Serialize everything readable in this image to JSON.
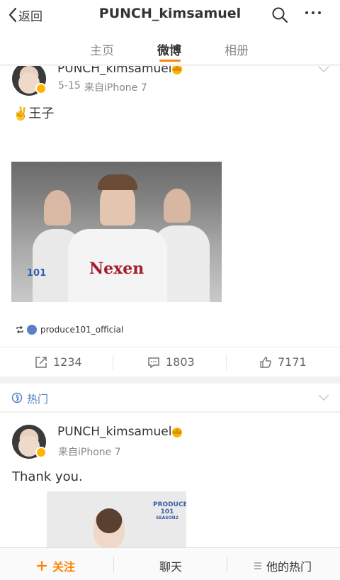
{
  "nav": {
    "back_label": "返回",
    "title": "PUNCH_kimsamuel",
    "search_icon": "search-icon",
    "more_icon": "more-icon"
  },
  "tabs": [
    {
      "label": "主页",
      "active": false
    },
    {
      "label": "微博",
      "active": true
    },
    {
      "label": "相册",
      "active": false
    }
  ],
  "post1": {
    "username": "PUNCH_kimsamuel",
    "date": "5-15",
    "source": "来自iPhone 7",
    "emoji": "✌️",
    "text": "王子",
    "photo_text": "Nexen",
    "photo_logo": "101",
    "repost_user": "produce101_official",
    "actions": {
      "repost_count": "1234",
      "comment_count": "1803",
      "like_count": "7171"
    }
  },
  "hot_section": {
    "label": "热门"
  },
  "post2": {
    "username": "PUNCH_kimsamuel",
    "source": "来自iPhone 7",
    "text": "Thank you.",
    "poster_logo": "PRODUCE 101",
    "poster_sub": "SEASON2"
  },
  "bottom": {
    "follow_label": "关注",
    "chat_label": "聊天",
    "hot_label": "他的热门"
  },
  "colors": {
    "accent": "#ff8200",
    "link": "#4a7ec2",
    "verified": "#ffb400"
  }
}
